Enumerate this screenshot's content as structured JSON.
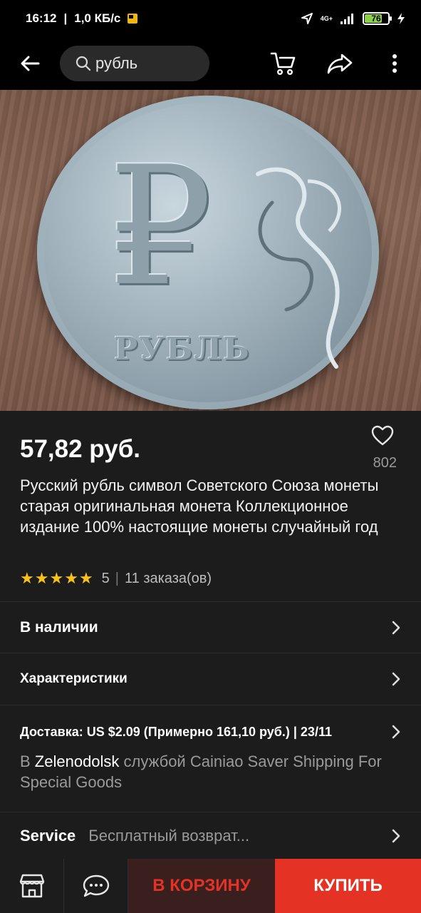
{
  "status_bar": {
    "time": "16:12",
    "speed": "1,0 КБ/с",
    "network": "4G+",
    "battery": "76",
    "battery_level": 0.76
  },
  "app_bar": {
    "search_text": "рубль",
    "icons": [
      "back-arrow-icon",
      "search-icon",
      "cart-icon",
      "share-icon",
      "more-icon"
    ]
  },
  "product": {
    "price": "57,82 руб.",
    "likes": "802",
    "title": "Русский рубль символ Советского Союза монеты старая оригинальная монета Коллекционное издание 100% настоящие монеты случайный год",
    "rating": "5",
    "orders": "11 заказа(ов)"
  },
  "sections": {
    "stock": "В наличии",
    "specs": "Характеристики"
  },
  "delivery": {
    "head": "Доставка: US $2.09 (Примерно 161,10 руб.) | 23/11",
    "prefix": "В ",
    "city": "Zelenodolsk",
    "body": " службой Cainiao Saver Shipping For Special Goods"
  },
  "service": {
    "label": "Service",
    "value": "Бесплатный возврат..."
  },
  "bottom_bar": {
    "cart_label": "В КОРЗИНУ",
    "buy_label": "КУПИТЬ"
  },
  "colors": {
    "accent": "#e43225",
    "star": "#f6c21b",
    "background": "#1c1c1c"
  }
}
